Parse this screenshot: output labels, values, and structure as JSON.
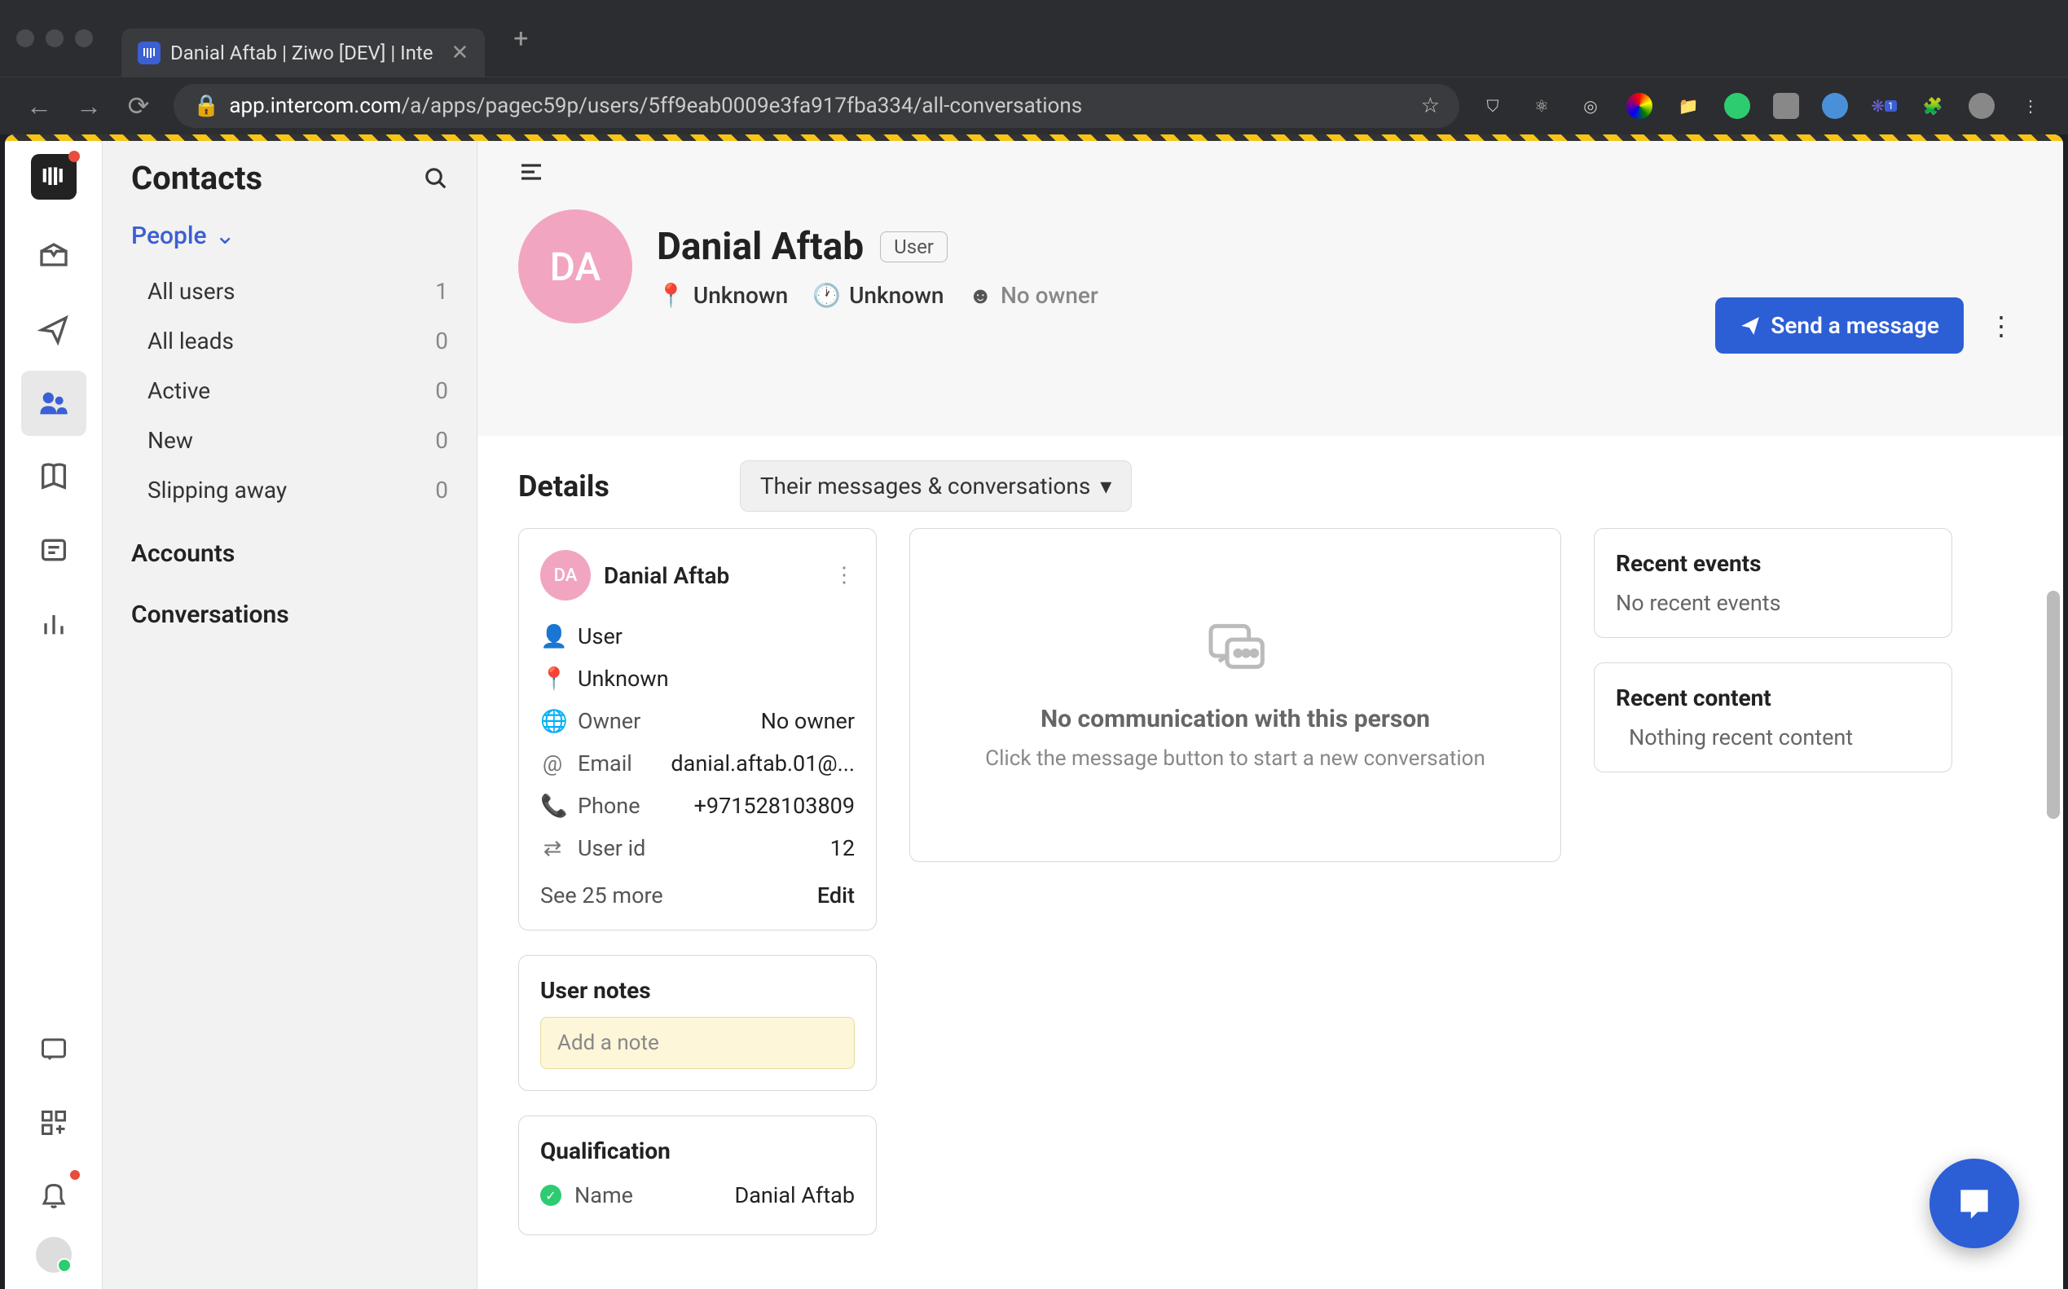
{
  "browser": {
    "tab_title": "Danial Aftab | Ziwo [DEV] | Inte",
    "url_domain": "app.intercom.com",
    "url_path": "/a/apps/pagec59p/users/5ff9eab0009e3fa917fba334/all-conversations"
  },
  "sidebar": {
    "title": "Contacts",
    "dropdown": "People",
    "items": [
      {
        "label": "All users",
        "count": "1"
      },
      {
        "label": "All leads",
        "count": "0"
      },
      {
        "label": "Active",
        "count": "0"
      },
      {
        "label": "New",
        "count": "0"
      },
      {
        "label": "Slipping away",
        "count": "0"
      }
    ],
    "accounts": "Accounts",
    "conversations": "Conversations"
  },
  "contact": {
    "initials": "DA",
    "name": "Danial Aftab",
    "badge": "User",
    "location": "Unknown",
    "time": "Unknown",
    "owner": "No owner",
    "send_btn": "Send a message"
  },
  "details": {
    "title": "Details",
    "dropdown": "Their messages & conversations"
  },
  "card": {
    "initials": "DA",
    "name": "Danial Aftab",
    "type": "User",
    "location": "Unknown",
    "owner_label": "Owner",
    "owner_val": "No owner",
    "email_label": "Email",
    "email_val": "danial.aftab.01@...",
    "phone_label": "Phone",
    "phone_val": "+971528103809",
    "userid_label": "User id",
    "userid_val": "12",
    "see_more": "See 25 more",
    "edit": "Edit"
  },
  "notes": {
    "title": "User notes",
    "placeholder": "Add a note"
  },
  "qualification": {
    "title": "Qualification",
    "name_label": "Name",
    "name_val": "Danial Aftab"
  },
  "empty": {
    "title": "No communication with this person",
    "sub": "Click the message button to start a new conversation"
  },
  "events": {
    "title": "Recent events",
    "empty": "No recent events"
  },
  "content": {
    "title": "Recent content",
    "empty": "Nothing recent content"
  }
}
